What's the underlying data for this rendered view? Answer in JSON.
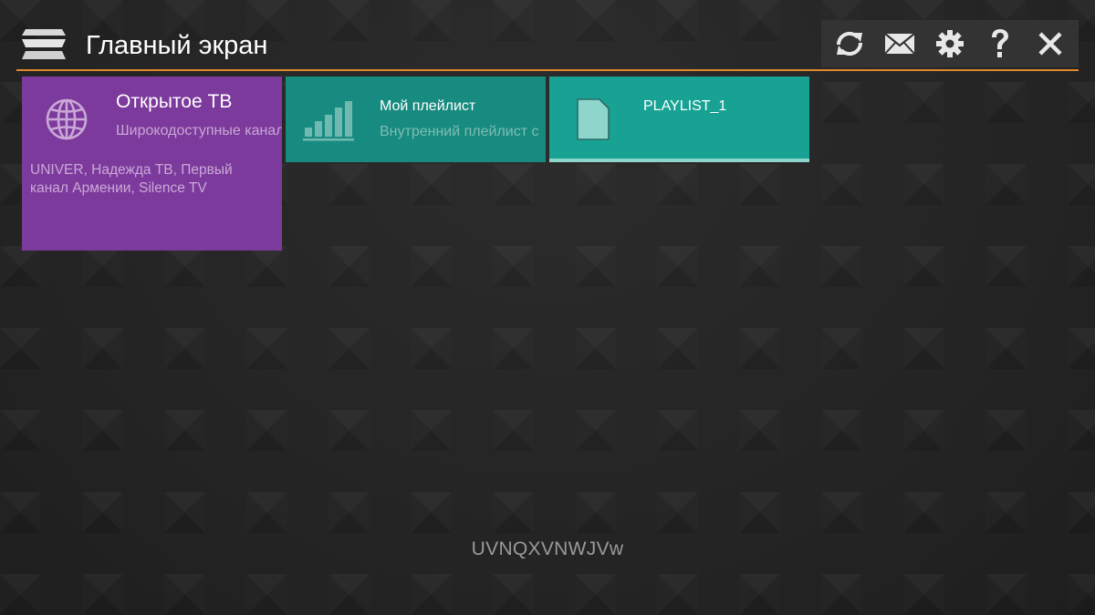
{
  "header": {
    "title": "Главный экран",
    "menu_icon": "hamburger-stack-icon",
    "accent_color": "#e0892d",
    "toolbar": {
      "refresh_icon": "refresh-icon",
      "messages_icon": "envelope-icon",
      "settings_icon": "gear-icon",
      "help_icon": "question-icon",
      "close_icon": "close-icon"
    }
  },
  "tiles": [
    {
      "title": "Открытое ТВ",
      "subtitle": "Широкодоступные каналы",
      "description": "UNIVER, Надежда ТВ, Первый канал Армении, Silence TV",
      "icon": "globe-icon",
      "color": "#7c3a9c"
    },
    {
      "title": "Мой плейлист",
      "subtitle": "Внутренний плейлист с",
      "icon": "signal-bars-icon",
      "color": "#188b80"
    },
    {
      "title": "PLAYLIST_1",
      "icon": "file-icon",
      "color": "#17a294",
      "selected": true
    }
  ],
  "footer": {
    "code": "UVNQXVNWJVw"
  }
}
